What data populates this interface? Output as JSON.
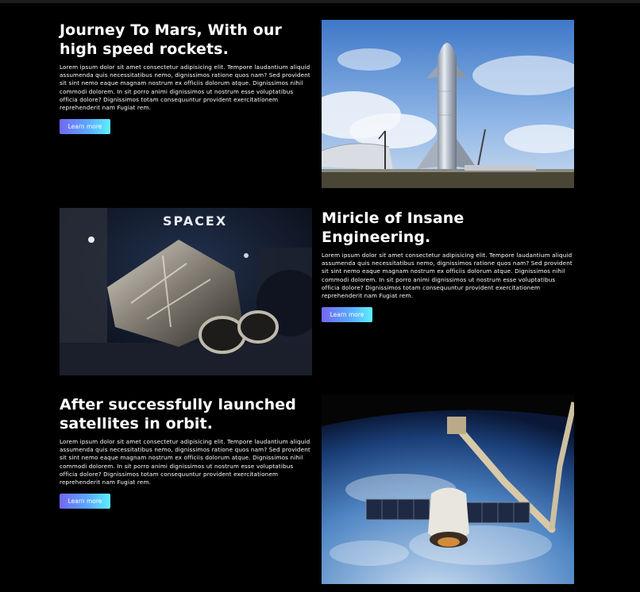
{
  "sections": [
    {
      "title": "Journey To Mars, With our high speed rockets.",
      "body": "Lorem ipsum dolor sit amet consectetur adipisicing elit. Tempore laudantium aliquid assumenda quis necessitatibus nemo, dignissimos ratione quos nam? Sed provident sit sint nemo eaque magnam nostrum ex officiis dolorum atque. Dignissimos nihil commodi dolorem. In sit porro animi dignissimos ut nostrum esse voluptatibus officia dolore? Dignissimos totam consequuntur provident exercitationem reprehenderit nam Fugiat rem.",
      "button": "Learn more"
    },
    {
      "title": "Miricle of Insane Engineering.",
      "body": "Lorem ipsum dolor sit amet consectetur adipisicing elit. Tempore laudantium aliquid assumenda quis necessitatibus nemo, dignissimos ratione quos nam? Sed provident sit sint nemo eaque magnam nostrum ex officiis dolorum atque. Dignissimos nihil commodi dolorem. In sit porro animi dignissimos ut nostrum esse voluptatibus officia dolore? Dignissimos totam consequuntur provident exercitationem reprehenderit nam Fugiat rem.",
      "button": "Learn more",
      "image_text": "SPACEX"
    },
    {
      "title": "After successfully launched satellites in orbit.",
      "body": "Lorem ipsum dolor sit amet consectetur adipisicing elit. Tempore laudantium aliquid assumenda quis necessitatibus nemo, dignissimos ratione quos nam? Sed provident sit sint nemo eaque magnam nostrum ex officiis dolorum atque. Dignissimos nihil commodi dolorem. In sit porro animi dignissimos ut nostrum esse voluptatibus officia dolore? Dignissimos totam consequuntur provident exercitationem reprehenderit nam Fugiat rem.",
      "button": "Learn more"
    }
  ],
  "colors": {
    "background": "#000000",
    "text": "#ffffff",
    "button_gradient_start": "#7367f0",
    "button_gradient_end": "#5ef0ff"
  }
}
